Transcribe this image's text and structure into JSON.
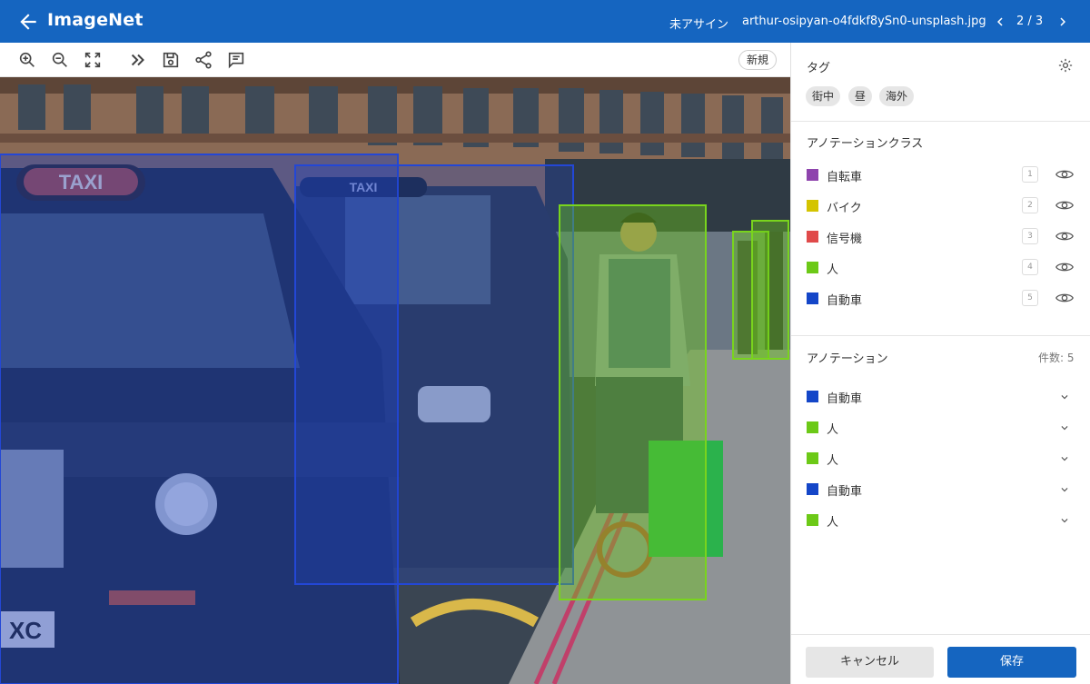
{
  "header": {
    "title": "ImageNet",
    "status": "未アサイン",
    "filename": "arthur-osipyan-o4fdkf8ySn0-unsplash.jpg",
    "pager": "2 / 3"
  },
  "toolbar": {
    "icons": [
      "zoom-in-icon",
      "zoom-out-icon",
      "fit-screen-icon",
      "forward-icon",
      "save-icon",
      "share-icon",
      "comment-icon"
    ],
    "new_label": "新規"
  },
  "scene": {
    "taxi_sign_1": "TAXI",
    "taxi_sign_2": "TAXI",
    "plate": "XC"
  },
  "tags": {
    "title": "タグ",
    "items": [
      "街中",
      "昼",
      "海外"
    ]
  },
  "classes": {
    "title": "アノテーションクラス",
    "items": [
      {
        "label": "自転車",
        "key": "1",
        "color": "#8e44ad"
      },
      {
        "label": "バイク",
        "key": "2",
        "color": "#d4c400"
      },
      {
        "label": "信号機",
        "key": "3",
        "color": "#e04a4a"
      },
      {
        "label": "人",
        "key": "4",
        "color": "#6cc917"
      },
      {
        "label": "自動車",
        "key": "5",
        "color": "#1446c8"
      }
    ]
  },
  "annotations": {
    "title": "アノテーション",
    "count": "件数: 5",
    "items": [
      {
        "label": "自動車",
        "color": "#1446c8"
      },
      {
        "label": "人",
        "color": "#6cc917"
      },
      {
        "label": "人",
        "color": "#6cc917"
      },
      {
        "label": "自動車",
        "color": "#1446c8"
      },
      {
        "label": "人",
        "color": "#6cc917"
      }
    ]
  },
  "footer": {
    "cancel_label": "キャンセル",
    "save_label": "保存"
  }
}
